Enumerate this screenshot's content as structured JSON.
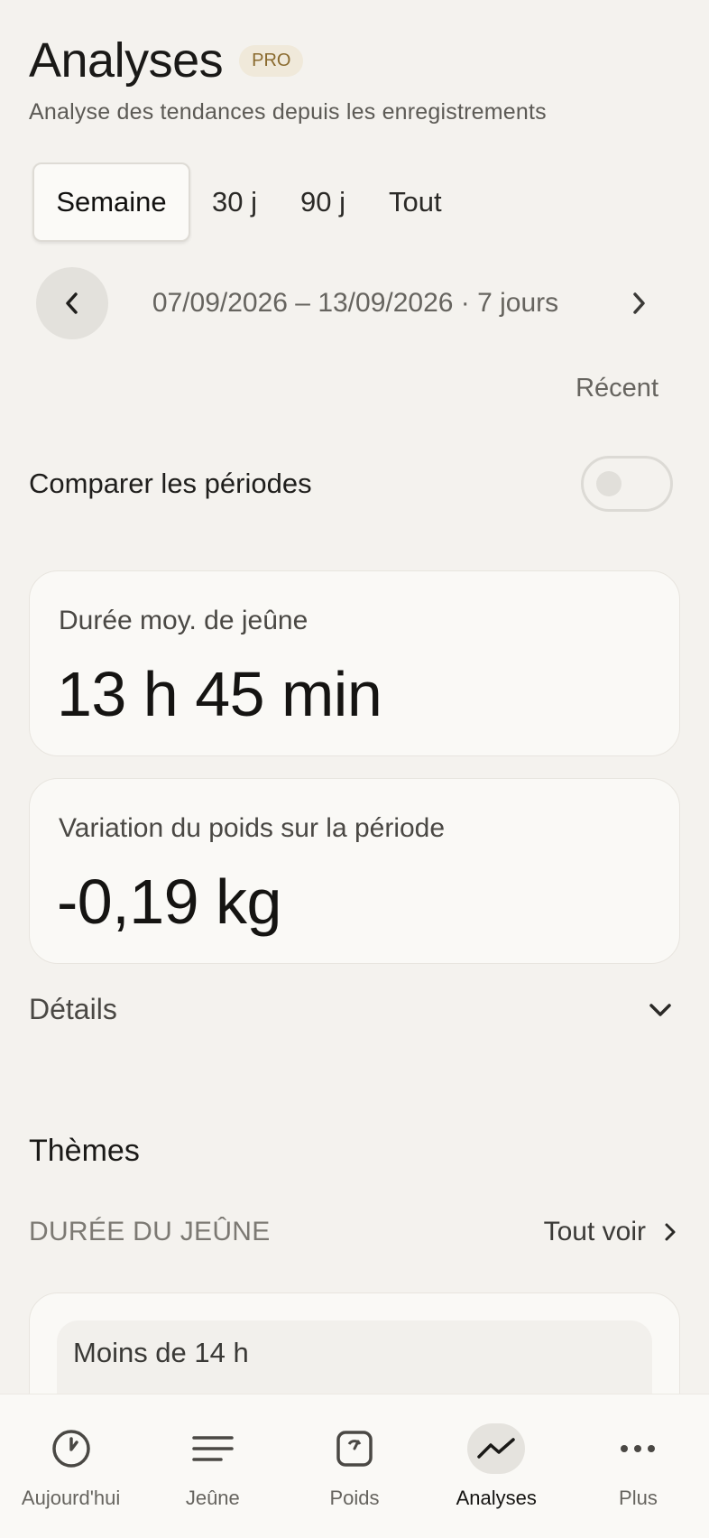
{
  "header": {
    "title": "Analyses",
    "badge": "PRO",
    "subtitle": "Analyse des tendances depuis les enregistrements"
  },
  "range_tabs": [
    {
      "label": "Semaine",
      "active": true
    },
    {
      "label": "30 j",
      "active": false
    },
    {
      "label": "90 j",
      "active": false
    },
    {
      "label": "Tout",
      "active": false
    }
  ],
  "date_nav": {
    "label": "07/09/2026 – 13/09/2026 · 7 jours"
  },
  "recent_label": "Récent",
  "compare": {
    "label": "Comparer les périodes",
    "enabled": false
  },
  "stats": [
    {
      "label": "Durée moy. de jeûne",
      "value": "13 h 45 min"
    },
    {
      "label": "Variation du poids sur la période",
      "value": "-0,19 kg"
    }
  ],
  "details_label": "Détails",
  "themes": {
    "title": "Thèmes",
    "section_title": "DURÉE DU JEÛNE",
    "see_all": "Tout voir",
    "first_item": "Moins de 14 h"
  },
  "bottom_nav": [
    {
      "label": "Aujourd'hui",
      "icon": "clock-icon",
      "active": false
    },
    {
      "label": "Jeûne",
      "icon": "lines-icon",
      "active": false
    },
    {
      "label": "Poids",
      "icon": "scale-icon",
      "active": false
    },
    {
      "label": "Analyses",
      "icon": "trend-icon",
      "active": true
    },
    {
      "label": "Plus",
      "icon": "more-icon",
      "active": false
    }
  ],
  "colors": {
    "background": "#f4f2ee",
    "card": "#faf9f6",
    "badge_bg": "#f0e9da",
    "badge_text": "#8a6a2e"
  }
}
